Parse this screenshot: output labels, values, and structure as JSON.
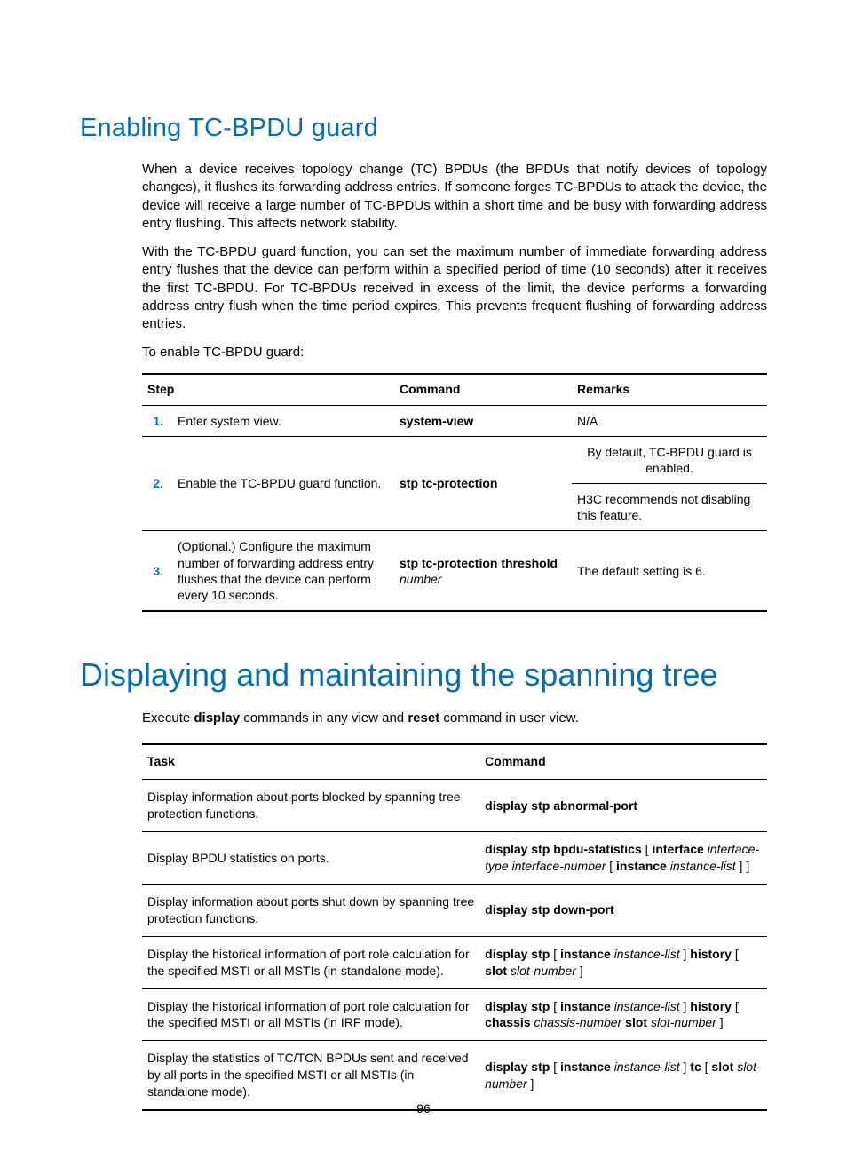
{
  "section1": {
    "title": "Enabling TC-BPDU guard",
    "para1": "When a device receives topology change (TC) BPDUs (the BPDUs that notify devices of topology changes), it flushes its forwarding address entries. If someone forges TC-BPDUs to attack the device, the device will receive a large number of TC-BPDUs within a short time and be busy with forwarding address entry flushing. This affects network stability.",
    "para2": "With the TC-BPDU guard function, you can set the maximum number of immediate forwarding address entry flushes that the device can perform within a specified period of time (10 seconds) after it receives the first TC-BPDU. For TC-BPDUs received in excess of the limit, the device performs a forwarding address entry flush when the time period expires. This prevents frequent flushing of forwarding address entries.",
    "para3": "To enable TC-BPDU guard:",
    "table": {
      "headers": {
        "step": "Step",
        "command": "Command",
        "remarks": "Remarks"
      },
      "rows": [
        {
          "num": "1.",
          "step": "Enter system view.",
          "cmd_bold": "system-view",
          "remarks_plain": "N/A"
        },
        {
          "num": "2.",
          "step": "Enable the TC-BPDU guard function.",
          "cmd_bold": "stp tc-protection",
          "remarks_line1": "By default, TC-BPDU guard is enabled.",
          "remarks_line2": "H3C recommends not disabling this feature."
        },
        {
          "num": "3.",
          "step": "(Optional.) Configure the maximum number of forwarding address entry flushes that the device can perform every 10 seconds.",
          "cmd_bold": "stp tc-protection threshold",
          "cmd_italic": "number",
          "remarks_plain": "The default setting is 6."
        }
      ]
    }
  },
  "section2": {
    "title": "Displaying and maintaining the spanning tree",
    "intro_pre": "Execute ",
    "intro_b1": "display",
    "intro_mid": " commands in any view and ",
    "intro_b2": "reset",
    "intro_post": " command in user view.",
    "table": {
      "headers": {
        "task": "Task",
        "command": "Command"
      },
      "rows": [
        {
          "task": "Display information about ports blocked by spanning tree protection functions.",
          "cmd": [
            {
              "b": "display stp abnormal-port"
            }
          ]
        },
        {
          "task": "Display BPDU statistics on ports.",
          "cmd": [
            {
              "b": "display stp bpdu-statistics"
            },
            {
              "t": " [ "
            },
            {
              "b": "interface"
            },
            {
              "t": " "
            },
            {
              "i": "interface-type interface-number"
            },
            {
              "t": " [ "
            },
            {
              "b": "instance"
            },
            {
              "t": " "
            },
            {
              "i": "instance-list"
            },
            {
              "t": " ] ]"
            }
          ]
        },
        {
          "task": "Display information about ports shut down by spanning tree protection functions.",
          "cmd": [
            {
              "b": "display stp down-port"
            }
          ]
        },
        {
          "task": "Display the historical information of port role calculation for the specified MSTI or all MSTIs (in standalone mode).",
          "cmd": [
            {
              "b": "display stp"
            },
            {
              "t": " [ "
            },
            {
              "b": "instance"
            },
            {
              "t": " "
            },
            {
              "i": "instance-list"
            },
            {
              "t": " ] "
            },
            {
              "b": "history"
            },
            {
              "t": " [ "
            },
            {
              "b": "slot"
            },
            {
              "t": " "
            },
            {
              "i": "slot-number"
            },
            {
              "t": " ]"
            }
          ]
        },
        {
          "task": "Display the historical information of port role calculation for the specified MSTI or all MSTIs (in IRF mode).",
          "cmd": [
            {
              "b": "display stp"
            },
            {
              "t": " [ "
            },
            {
              "b": "instance"
            },
            {
              "t": " "
            },
            {
              "i": "instance-list"
            },
            {
              "t": " ] "
            },
            {
              "b": "history"
            },
            {
              "t": " [ "
            },
            {
              "b": "chassis"
            },
            {
              "t": " "
            },
            {
              "i": "chassis-number"
            },
            {
              "t": " "
            },
            {
              "b": "slot"
            },
            {
              "t": " "
            },
            {
              "i": "slot-number"
            },
            {
              "t": " ]"
            }
          ]
        },
        {
          "task": "Display the statistics of TC/TCN BPDUs sent and received by all ports in the specified MSTI or all MSTIs (in standalone mode).",
          "cmd": [
            {
              "b": "display stp"
            },
            {
              "t": " [ "
            },
            {
              "b": "instance"
            },
            {
              "t": " "
            },
            {
              "i": "instance-list"
            },
            {
              "t": " ] "
            },
            {
              "b": "tc"
            },
            {
              "t": " [ "
            },
            {
              "b": "slot"
            },
            {
              "t": " "
            },
            {
              "i": "slot-number"
            },
            {
              "t": " ]"
            }
          ]
        }
      ]
    }
  },
  "page_number": "96"
}
